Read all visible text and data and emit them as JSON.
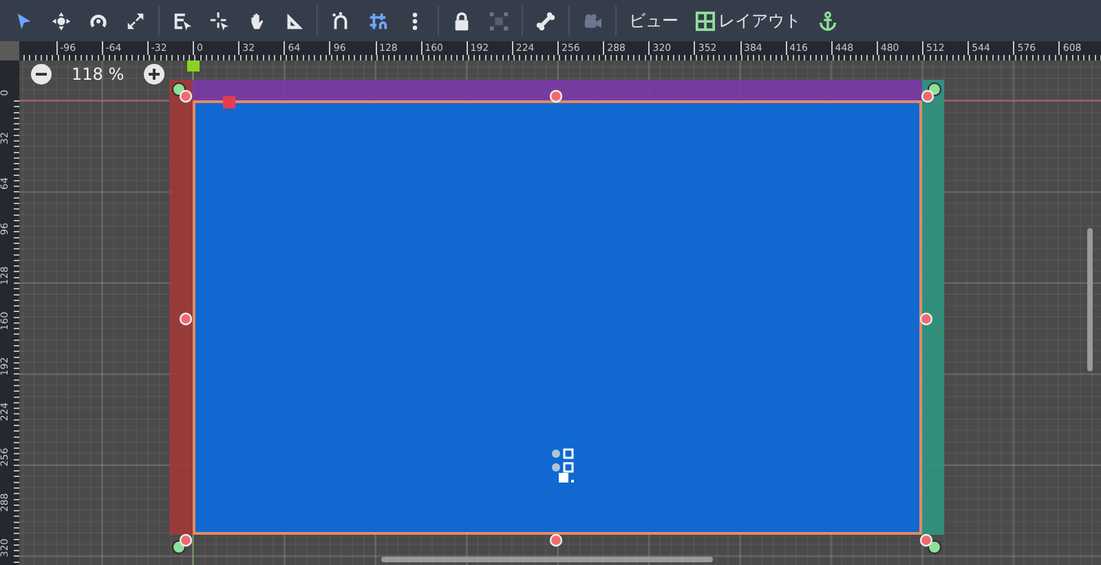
{
  "toolbar": {
    "groups": [
      [
        {
          "kind": "select",
          "active": true,
          "disabled": false
        },
        {
          "kind": "move",
          "active": false,
          "disabled": false
        },
        {
          "kind": "rotate",
          "active": false,
          "disabled": false
        },
        {
          "kind": "scale",
          "active": false,
          "disabled": false
        }
      ],
      [
        {
          "kind": "list-select",
          "active": false,
          "disabled": false
        },
        {
          "kind": "pivot",
          "active": false,
          "disabled": false
        },
        {
          "kind": "pan",
          "active": false,
          "disabled": false
        },
        {
          "kind": "ruler",
          "active": false,
          "disabled": false
        }
      ],
      [
        {
          "kind": "smart-snap",
          "active": false,
          "disabled": false
        },
        {
          "kind": "grid-snap",
          "active": true,
          "disabled": false
        },
        {
          "kind": "more",
          "active": false,
          "disabled": false
        }
      ],
      [
        {
          "kind": "lock",
          "active": false,
          "disabled": false
        },
        {
          "kind": "group",
          "active": false,
          "disabled": true
        }
      ],
      [
        {
          "kind": "bone",
          "active": false,
          "disabled": false
        }
      ],
      [
        {
          "kind": "camera",
          "active": false,
          "disabled": true
        }
      ]
    ],
    "menus": [
      {
        "kind": "plain",
        "label": "ビュー"
      },
      {
        "kind": "grid",
        "label": "レイアウト"
      },
      {
        "kind": "anchor"
      }
    ]
  },
  "ruler_top": {
    "labels": [
      "-96",
      "-64",
      "-32",
      "0",
      "32",
      "64",
      "96",
      "128",
      "160",
      "192",
      "224",
      "256",
      "288",
      "320",
      "352",
      "384",
      "416",
      "448",
      "480",
      "512",
      "544",
      "576",
      "608"
    ]
  },
  "ruler_left": {
    "labels": [
      "0",
      "32",
      "64",
      "96",
      "128",
      "160",
      "192",
      "224",
      "256",
      "288",
      "320"
    ]
  },
  "zoom": {
    "value": "118 %"
  }
}
